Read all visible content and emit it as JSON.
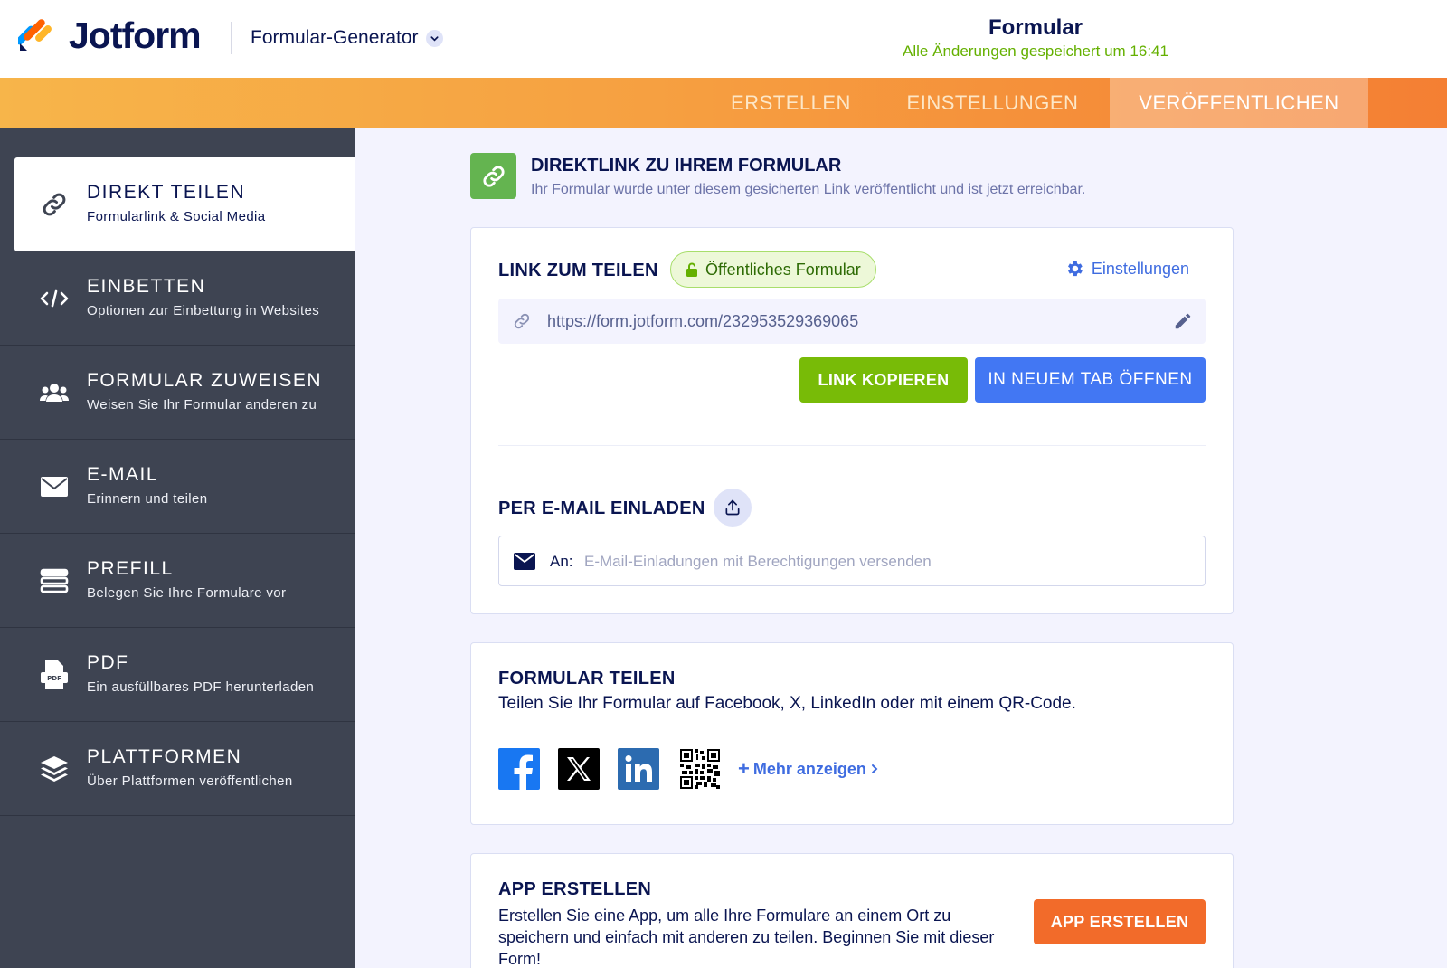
{
  "header": {
    "brand": "Jotform",
    "generator_label": "Formular-Generator",
    "form_title": "Formular",
    "saved_status": "Alle Änderungen gespeichert um 16:41"
  },
  "nav": {
    "tabs": [
      {
        "label": "ERSTELLEN",
        "active": false
      },
      {
        "label": "EINSTELLUNGEN",
        "active": false
      },
      {
        "label": "VERÖFFENTLICHEN",
        "active": true
      }
    ]
  },
  "sidebar": {
    "items": [
      {
        "title": "DIREKT TEILEN",
        "subtitle": "Formularlink & Social Media",
        "icon": "link-icon",
        "active": true
      },
      {
        "title": "EINBETTEN",
        "subtitle": "Optionen zur Einbettung in Websites",
        "icon": "code-icon",
        "active": false
      },
      {
        "title": "FORMULAR ZUWEISEN",
        "subtitle": "Weisen Sie Ihr Formular anderen zu",
        "icon": "users-icon",
        "active": false
      },
      {
        "title": "E-MAIL",
        "subtitle": "Erinnern und teilen",
        "icon": "envelope-icon",
        "active": false
      },
      {
        "title": "PREFILL",
        "subtitle": "Belegen Sie Ihre Formulare vor",
        "icon": "prefill-icon",
        "active": false
      },
      {
        "title": "PDF",
        "subtitle": "Ein ausfüllbares PDF herunterladen",
        "icon": "pdf-icon",
        "active": false
      },
      {
        "title": "PLATTFORMEN",
        "subtitle": "Über Plattformen veröffentlichen",
        "icon": "layers-icon",
        "active": false
      }
    ]
  },
  "direct_link": {
    "title": "DIREKTLINK ZU IHREM FORMULAR",
    "subtitle": "Ihr Formular wurde unter diesem gesicherten Link veröffentlicht und ist jetzt erreichbar."
  },
  "share_link": {
    "title": "LINK ZUM TEILEN",
    "badge": "Öffentliches Formular",
    "settings_label": "Einstellungen",
    "url": "https://form.jotform.com/232953529369065",
    "copy_button": "LINK KOPIEREN",
    "open_button": "IN NEUEM TAB ÖFFNEN"
  },
  "email_invite": {
    "title": "PER E-MAIL EINLADEN",
    "to_label": "An:",
    "placeholder": "E-Mail-Einladungen mit Berechtigungen versenden"
  },
  "share_form": {
    "title": "FORMULAR TEILEN",
    "subtitle": "Teilen Sie Ihr Formular auf Facebook, X, LinkedIn oder mit einem QR-Code.",
    "more_label": "Mehr anzeigen",
    "networks": [
      "facebook-icon",
      "x-icon",
      "linkedin-icon",
      "qr-code-icon"
    ]
  },
  "app": {
    "title": "APP ERSTELLEN",
    "description": "Erstellen Sie eine App, um alle Ihre Formulare an einem Ort zu speichern und einfach mit anderen zu teilen. Beginnen Sie mit dieser Form!",
    "button": "APP ERSTELLEN"
  },
  "colors": {
    "navy": "#0a1551",
    "green": "#78bb07",
    "blue": "#4277f3",
    "orange": "#f26b2a",
    "sidebar": "#3e4452"
  }
}
